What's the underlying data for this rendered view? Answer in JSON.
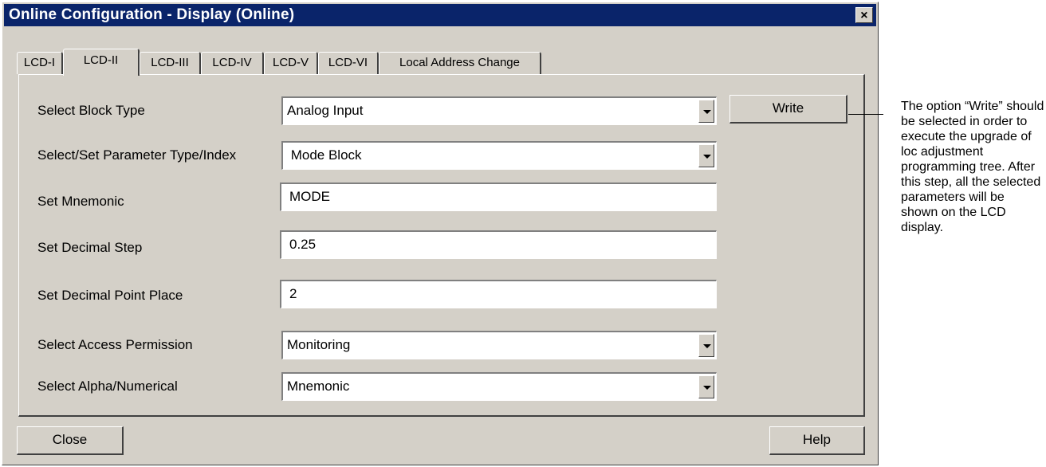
{
  "window": {
    "title": "Online Configuration - Display  (Online)",
    "close_glyph": "×"
  },
  "tabs": [
    {
      "label": "LCD-I",
      "active": false
    },
    {
      "label": "LCD-II",
      "active": true
    },
    {
      "label": "LCD-III",
      "active": false
    },
    {
      "label": "LCD-IV",
      "active": false
    },
    {
      "label": "LCD-V",
      "active": false
    },
    {
      "label": "LCD-VI",
      "active": false
    },
    {
      "label": "Local Address Change",
      "active": false
    }
  ],
  "form": {
    "block_type": {
      "label": "Select Block Type",
      "value": "Analog Input"
    },
    "parameter": {
      "label": "Select/Set Parameter Type/Index",
      "value": " Mode Block"
    },
    "mnemonic": {
      "label": "Set Mnemonic",
      "value": "MODE"
    },
    "decimal_step": {
      "label": "Set Decimal Step",
      "value": "0.25"
    },
    "decimal_point": {
      "label": "Set Decimal Point Place",
      "value": "2"
    },
    "access": {
      "label": "Select Access Permission",
      "value": "Monitoring"
    },
    "alpha": {
      "label": "Select Alpha/Numerical",
      "value": "Mnemonic"
    }
  },
  "buttons": {
    "write": "Write",
    "close": "Close",
    "help": "Help"
  },
  "annotation": {
    "text": "The option “Write” should be selected in order to execute the upgrade of loc adjustment programming tree. After this step, all the selected parameters will be shown on the LCD display."
  }
}
